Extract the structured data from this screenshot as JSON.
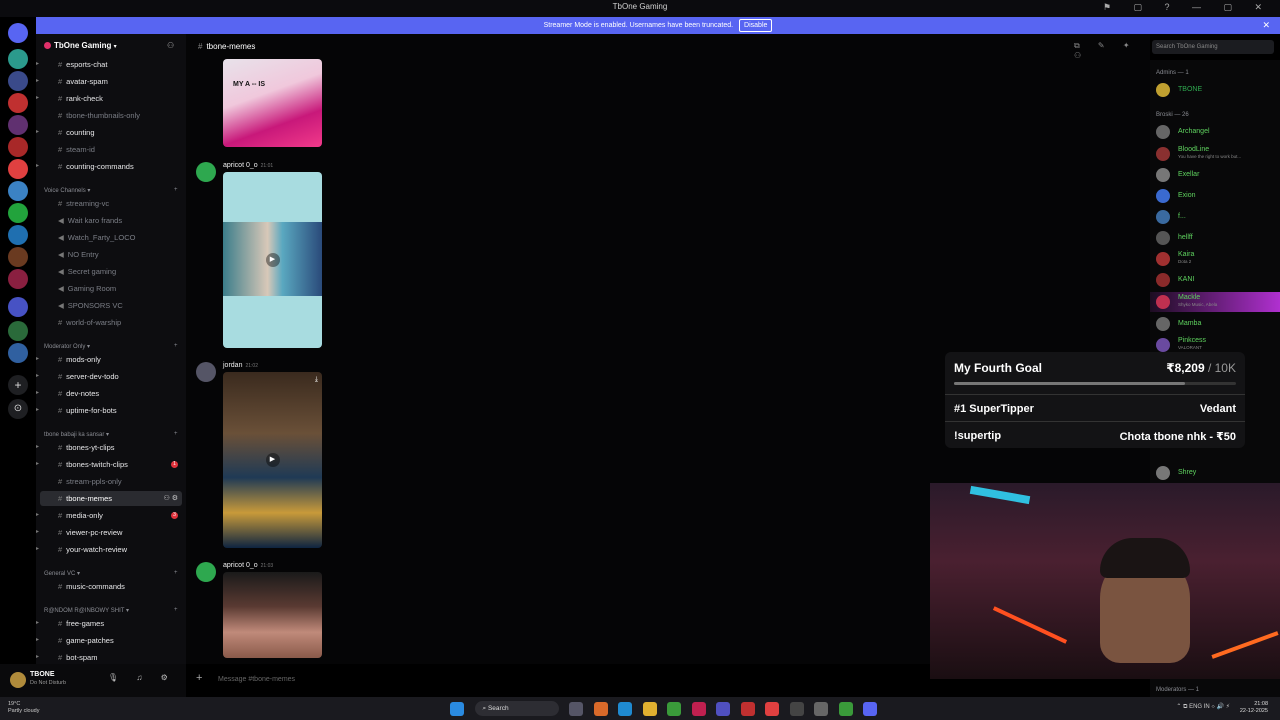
{
  "window": {
    "title": "TbOne Gaming"
  },
  "banner": {
    "text": "Streamer Mode is enabled. Usernames have been truncated.",
    "disable_label": "Disable"
  },
  "guild": {
    "name": "TbOne Gaming"
  },
  "channels": [
    {
      "label": "esports-chat"
    },
    {
      "label": "avatar-spam"
    },
    {
      "label": "rank-check"
    },
    {
      "label": "tbone-thumbnails-only"
    },
    {
      "label": "counting"
    },
    {
      "label": "steam-id"
    },
    {
      "label": "counting-commands"
    }
  ],
  "voice_category": "Voice Channels",
  "voice_channels": [
    {
      "label": "streaming-vc"
    },
    {
      "label": "Wait karo frands"
    },
    {
      "label": "Watch_Farty_LOCO"
    },
    {
      "label": "NO Entry"
    },
    {
      "label": "Secret gaming"
    },
    {
      "label": "Gaming Room"
    },
    {
      "label": "SPONSORS VC"
    },
    {
      "label": "world-of-warship"
    }
  ],
  "mod_category": "Moderator Only",
  "mod_channels": [
    {
      "label": "mods-only"
    },
    {
      "label": "server-dev-todo"
    },
    {
      "label": "dev-notes"
    },
    {
      "label": "uptime-for-bots"
    }
  ],
  "babaji_category": "tbone babaji ka sansar",
  "babaji_channels": [
    {
      "label": "tbones-yt-clips"
    },
    {
      "label": "tbones-twitch-clips",
      "badge": "1"
    },
    {
      "label": "stream-ppls-only"
    },
    {
      "label": "tbone-memes"
    },
    {
      "label": "media-only",
      "badge": "3"
    },
    {
      "label": "viewer-pc-review"
    },
    {
      "label": "your-watch-review"
    }
  ],
  "general_category": "General VC",
  "general_channels": [
    {
      "label": "music-commands"
    }
  ],
  "random_category": "R@NDOM R@INBOWY SHIT",
  "random_channels": [
    {
      "label": "free-games"
    },
    {
      "label": "game-patches"
    },
    {
      "label": "bot-spam"
    }
  ],
  "user": {
    "name": "TBONE",
    "status": "Do Not Disturb"
  },
  "channel_header": {
    "name": "tbone-memes"
  },
  "search": {
    "placeholder": "Search TbOne Gaming"
  },
  "messages": [
    {
      "author": "apricot 0_o",
      "time": "21:01"
    },
    {
      "author": "jordan",
      "time": "21:02"
    },
    {
      "author": "apricot 0_o",
      "time": "21:03"
    }
  ],
  "top_image_caption": "MY A -- IS",
  "composer": {
    "placeholder": "Message #tbone-memes"
  },
  "members": {
    "admins_header": "Admins — 1",
    "broski_header": "Broski — 26",
    "moderators_header": "Moderators — 1",
    "list": [
      {
        "name": "TBONE"
      },
      {
        "name": "Archangel"
      },
      {
        "name": "BloodLine",
        "sub": "You have the right to work but..."
      },
      {
        "name": "Exellar"
      },
      {
        "name": "Exion"
      },
      {
        "name": "f..."
      },
      {
        "name": "hellff"
      },
      {
        "name": "Kaira",
        "sub": "Dota 2"
      },
      {
        "name": "KANI"
      },
      {
        "name": "Mackle",
        "sub": "Shyko Music, Abela"
      },
      {
        "name": "Mamba"
      },
      {
        "name": "Pinkcess",
        "sub": "VALORANT"
      },
      {
        "name": "Shrey"
      }
    ]
  },
  "goal_widget": {
    "title": "My Fourth Goal",
    "current": "₹8,209",
    "target": "/ 10K",
    "progress": 0.82,
    "supertipper_label": "#1 SuperTipper",
    "supertipper_name": "Vedant",
    "command_label": "!supertip",
    "command_text": "Chota tbone nhk - ₹50"
  },
  "taskbar": {
    "weather_temp": "19°C",
    "weather_desc": "Partly cloudy",
    "search_label": "Search",
    "lang1": "ENG",
    "lang2": "IN",
    "time": "21:08",
    "date": "22-12-2025"
  }
}
